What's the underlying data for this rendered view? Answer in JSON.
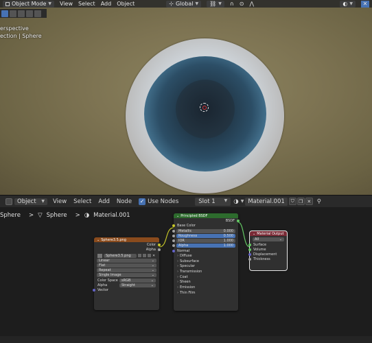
{
  "viewport": {
    "mode_label": "Object Mode",
    "menu": [
      "View",
      "Select",
      "Add",
      "Object"
    ],
    "transform_orientation": "Global",
    "info_line1": "erspective",
    "info_line2": "ection | Sphere"
  },
  "node_editor": {
    "editor_type": "Object",
    "menu": [
      "View",
      "Select",
      "Add",
      "Node"
    ],
    "use_nodes_label": "Use Nodes",
    "slot_label": "Slot 1",
    "material_name": "Material.001",
    "breadcrumb": [
      "Sphere",
      "Sphere",
      "Material.001"
    ],
    "image_node": {
      "title": "Sphere3.5.png",
      "outputs": [
        "Color",
        "Alpha"
      ],
      "image_name": "Sphere3.5.png",
      "interpolation": "Linear",
      "projection": "Flat",
      "extension": "Repeat",
      "source": "Single Image",
      "color_space_label": "Color Space",
      "color_space_value": "sRGB",
      "alpha_label": "Alpha",
      "alpha_value": "Straight",
      "input": "Vector"
    },
    "bsdf_node": {
      "title": "Principled BSDF",
      "output": "BSDF",
      "base_color": "Base Color",
      "metallic_label": "Metallic",
      "metallic_value": "0.000",
      "roughness_label": "Roughness",
      "roughness_value": "0.500",
      "ior_label": "IOR",
      "ior_value": "1.000",
      "alpha_label": "Alpha",
      "alpha_value": "1.000",
      "normal": "Normal",
      "panels": [
        "Diffuse",
        "Subsurface",
        "Specular",
        "Transmission",
        "Coat",
        "Sheen",
        "Emission",
        "Thin Film"
      ]
    },
    "output_node": {
      "title": "Material Output",
      "target": "All",
      "inputs": [
        "Surface",
        "Volume",
        "Displacement",
        "Thickness"
      ]
    }
  },
  "colors": {
    "image_node_header": "#8a4b1d",
    "bsdf_node_header": "#2d6b2d",
    "output_node_header": "#7a2a35",
    "accent_blue": "#4772b3",
    "socket_yellow": "#c7c729",
    "socket_grey": "#a1a1a1",
    "socket_purple": "#6363c7",
    "socket_green": "#63c763"
  }
}
